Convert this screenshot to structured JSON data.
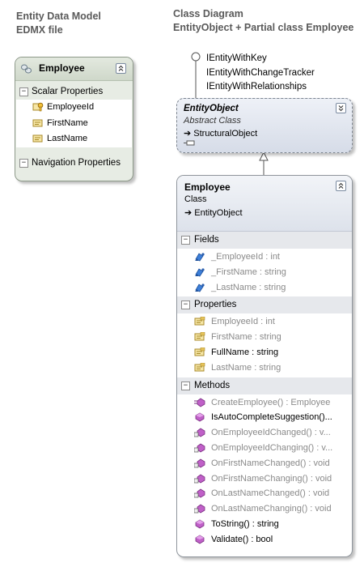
{
  "headings": {
    "left_line1": "Entity Data Model",
    "left_line2": "EDMX file",
    "right_line1": "Class Diagram",
    "right_line2": "EntityObject + Partial class Employee"
  },
  "edmx_entity": {
    "title": "Employee",
    "scalar_section": "Scalar Properties",
    "scalar_items": [
      "EmployeeId",
      "FirstName",
      "LastName"
    ],
    "navigation_section": "Navigation Properties"
  },
  "interfaces": [
    "IEntityWithKey",
    "IEntityWithChangeTracker",
    "IEntityWithRelationships"
  ],
  "entity_object": {
    "name": "EntityObject",
    "kind": "Abstract Class",
    "base": "StructuralObject"
  },
  "employee_class": {
    "name": "Employee",
    "kind": "Class",
    "base": "EntityObject",
    "fields_section": "Fields",
    "fields": [
      "_EmployeeId : int",
      "_FirstName : string",
      "_LastName : string"
    ],
    "properties_section": "Properties",
    "properties": [
      {
        "text": "EmployeeId : int",
        "partial": false
      },
      {
        "text": "FirstName : string",
        "partial": false
      },
      {
        "text": "FullName : string",
        "partial": true
      },
      {
        "text": "LastName : string",
        "partial": false
      }
    ],
    "methods_section": "Methods",
    "methods": [
      {
        "text": "CreateEmployee() : Employee",
        "partial": false,
        "icon": "static-method-icon"
      },
      {
        "text": "IsAutoCompleteSuggestion()...",
        "partial": true,
        "icon": "method-icon"
      },
      {
        "text": "OnEmployeeIdChanged() : v...",
        "partial": false,
        "icon": "partial-method-icon"
      },
      {
        "text": "OnEmployeeIdChanging() : v...",
        "partial": false,
        "icon": "partial-method-icon"
      },
      {
        "text": "OnFirstNameChanged() : void",
        "partial": false,
        "icon": "partial-method-icon"
      },
      {
        "text": "OnFirstNameChanging() : void",
        "partial": false,
        "icon": "partial-method-icon"
      },
      {
        "text": "OnLastNameChanged() : void",
        "partial": false,
        "icon": "partial-method-icon"
      },
      {
        "text": "OnLastNameChanging() : void",
        "partial": false,
        "icon": "partial-method-icon"
      },
      {
        "text": "ToString() : string",
        "partial": true,
        "icon": "method-icon"
      },
      {
        "text": "Validate() : bool",
        "partial": true,
        "icon": "method-icon"
      }
    ]
  }
}
